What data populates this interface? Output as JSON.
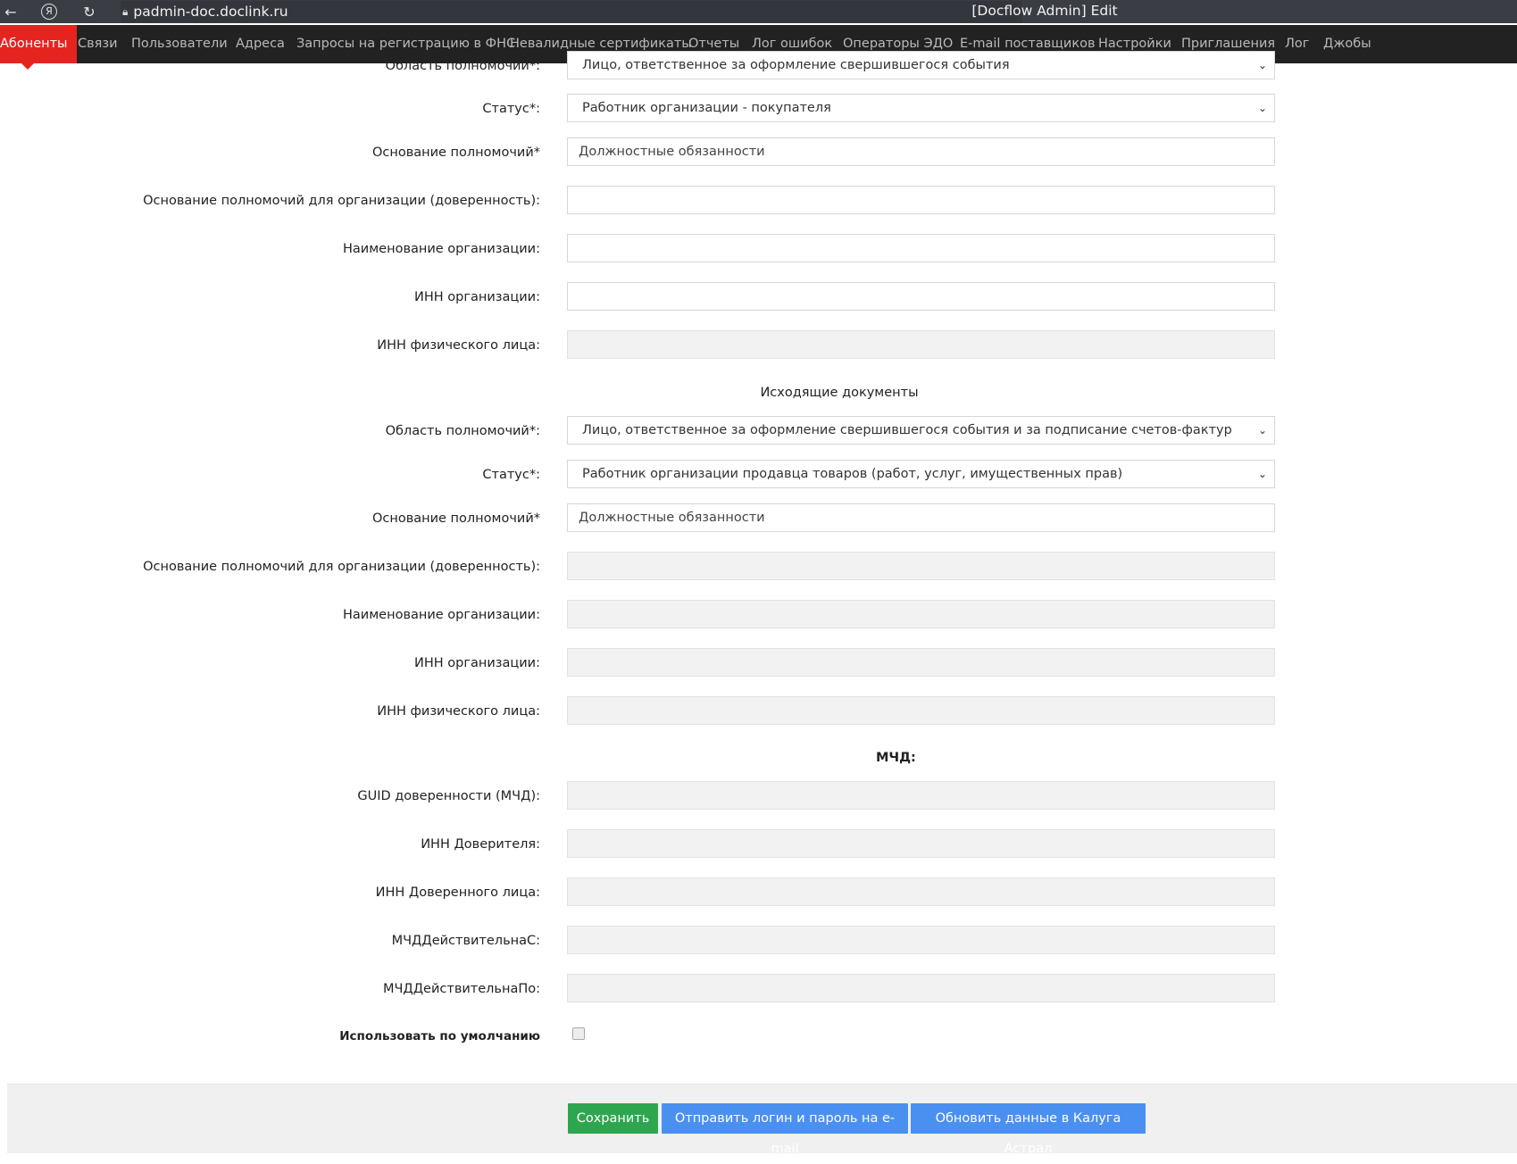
{
  "browser": {
    "url": "padmin-doc.doclink.ru",
    "title": "[Docflow Admin] Edit"
  },
  "nav": {
    "items": [
      "Абоненты",
      "Связи",
      "Пользователи",
      "Адреса",
      "Запросы на регистрацию в ФНС",
      "Невалидные сертификаты",
      "Отчеты",
      "Лог ошибок",
      "Операторы ЭДО",
      "E-mail поставщиков",
      "Настройки",
      "Приглашения",
      "Лог",
      "Джобы"
    ]
  },
  "incoming": {
    "scope_label": "Область полномочий*:",
    "scope_value": "Лицо, ответственное за оформление свершившегося события",
    "status_label": "Статус*:",
    "status_value": "Работник организации - покупателя",
    "basis_label": "Основание полномочий*",
    "basis_value": "Должностные обязанности",
    "org_basis_label": "Основание полномочий для организации (доверенность):",
    "org_name_label": "Наименование организации:",
    "org_inn_label": "ИНН организации:",
    "person_inn_label": "ИНН физического лица:"
  },
  "outgoing": {
    "section_title": "Исходящие документы",
    "scope_label": "Область полномочий*:",
    "scope_value": "Лицо, ответственное за оформление свершившегося события и за подписание счетов-фактур",
    "status_label": "Статус*:",
    "status_value": "Работник организации продавца товаров (работ, услуг, имущественных прав)",
    "basis_label": "Основание полномочий*",
    "basis_value": "Должностные обязанности",
    "org_basis_label": "Основание полномочий для организации (доверенность):",
    "org_name_label": "Наименование организации:",
    "org_inn_label": "ИНН организации:",
    "person_inn_label": "ИНН физического лица:"
  },
  "mchd": {
    "section_title": "МЧД:",
    "guid_label": "GUID доверенности (МЧД):",
    "principal_inn_label": "ИНН Доверителя:",
    "trustee_inn_label": "ИНН Доверенного лица:",
    "valid_from_label": "МЧДДействительнаС:",
    "valid_to_label": "МЧДДействительнаПо:",
    "default_label": "Использовать по умолчанию"
  },
  "buttons": {
    "save": "Сохранить",
    "send_login": "Отправить логин и пароль на e-mail",
    "update_kaluga": "Обновить данные в Калуга Астрал"
  }
}
